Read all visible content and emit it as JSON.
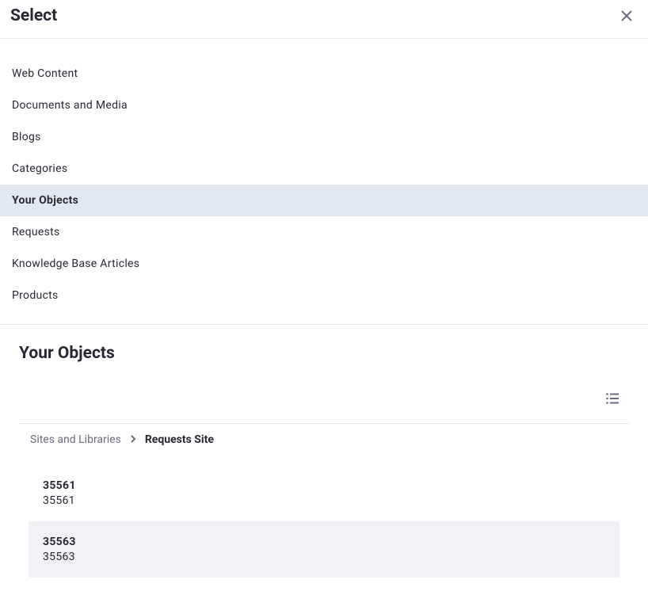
{
  "header": {
    "title": "Select"
  },
  "sidebar": {
    "items": [
      {
        "label": "Web Content",
        "active": false
      },
      {
        "label": "Documents and Media",
        "active": false
      },
      {
        "label": "Blogs",
        "active": false
      },
      {
        "label": "Categories",
        "active": false
      },
      {
        "label": "Your Objects",
        "active": true
      },
      {
        "label": "Requests",
        "active": false
      },
      {
        "label": "Knowledge Base Articles",
        "active": false
      },
      {
        "label": "Products",
        "active": false
      }
    ]
  },
  "content": {
    "title": "Your Objects"
  },
  "breadcrumb": {
    "root": "Sites and Libraries",
    "current": "Requests Site"
  },
  "objects": [
    {
      "title": "35561",
      "sub": "35561",
      "hover": false
    },
    {
      "title": "35563",
      "sub": "35563",
      "hover": true
    }
  ],
  "icons": {
    "close": "close-icon",
    "list_view": "list-view-icon",
    "chevron": "chevron-right-icon"
  }
}
